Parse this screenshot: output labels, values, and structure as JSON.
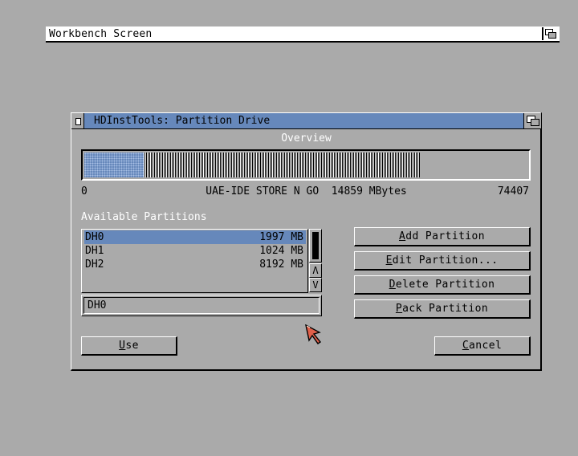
{
  "screen": {
    "title": "Workbench Screen"
  },
  "window": {
    "title": "HDInstTools: Partition Drive"
  },
  "overview": {
    "label": "Overview",
    "start": "0",
    "drive_info": "UAE-IDE STORE N GO  14859 MBytes",
    "end": "74407"
  },
  "partitions": {
    "label": "Available Partitions",
    "items": [
      {
        "name": "DH0",
        "size": "1997 MB",
        "selected": true
      },
      {
        "name": "DH1",
        "size": "1024 MB",
        "selected": false
      },
      {
        "name": "DH2",
        "size": "8192 MB",
        "selected": false
      }
    ],
    "current_name": "DH0"
  },
  "buttons": {
    "add": {
      "hotkey": "A",
      "rest": "dd Partition"
    },
    "edit": {
      "hotkey": "E",
      "rest": "dit Partition..."
    },
    "delete": {
      "hotkey": "D",
      "rest": "elete Partition"
    },
    "pack": {
      "hotkey": "P",
      "rest": "ack Partition"
    },
    "use": {
      "hotkey": "U",
      "rest": "se"
    },
    "cancel": {
      "hotkey": "C",
      "rest": "ancel"
    }
  },
  "scroll": {
    "up": "Λ",
    "down": "V"
  },
  "icons": [
    "depth-gadget-icon",
    "close-gadget-icon",
    "mouse-pointer-icon"
  ],
  "colors": {
    "background": "#aaaaaa",
    "accent": "#6688bb",
    "highlight": "#ffffff",
    "shadow": "#000000"
  }
}
